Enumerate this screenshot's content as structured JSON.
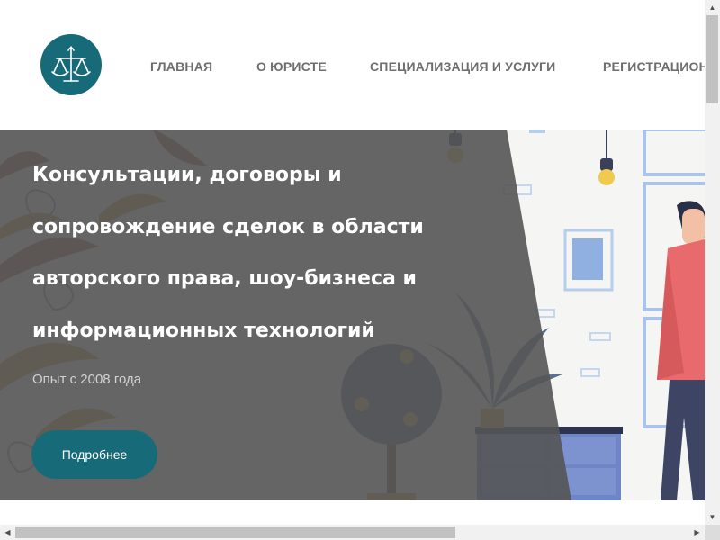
{
  "header": {
    "logo_icon": "scales-of-justice-icon",
    "nav": [
      {
        "label": "ГЛАВНАЯ"
      },
      {
        "label": "О ЮРИСТЕ"
      },
      {
        "label": "СПЕЦИАЛИЗАЦИЯ И УСЛУГИ"
      },
      {
        "label": "РЕГИСТРАЦИОН"
      }
    ]
  },
  "hero": {
    "title": "Консультации, договоры и сопровождение сделок в области авторского права, шоу-бизнеса и информационных технологий",
    "subtitle": "Опыт с 2008 года",
    "button_label": "Подробнее"
  },
  "colors": {
    "brand": "#176b78",
    "nav_text": "#6e6e6e",
    "overlay": "#555555"
  },
  "scrollbars": {
    "up_icon": "▲",
    "down_icon": "▼",
    "left_icon": "◀",
    "right_icon": "▶"
  }
}
